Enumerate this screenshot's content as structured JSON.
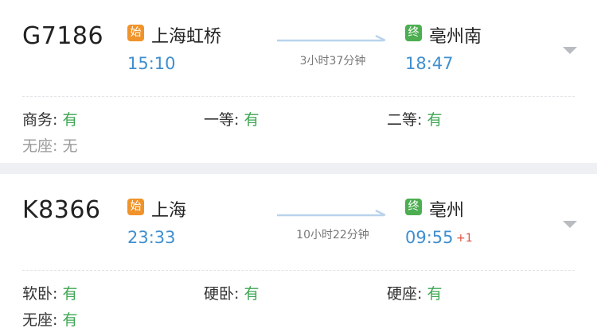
{
  "colors": {
    "time_blue": "#3f8fd0",
    "available_green": "#3ea653",
    "start_badge": "#f0932b",
    "end_badge": "#4cae50",
    "next_day_red": "#e24a3b"
  },
  "trains": [
    {
      "number": "G7186",
      "from": {
        "badge": "始",
        "station": "上海虹桥",
        "time": "15:10"
      },
      "to": {
        "badge": "终",
        "station": "亳州南",
        "time": "18:47",
        "day_offset": ""
      },
      "duration": "3小时37分钟",
      "expand_icon": "chevron-down-icon",
      "seats": [
        {
          "type": "商务:",
          "status": "有"
        },
        {
          "type": "一等:",
          "status": "有"
        },
        {
          "type": "二等:",
          "status": "有"
        },
        {
          "type": "无座:",
          "status": "无"
        }
      ]
    },
    {
      "number": "K8366",
      "from": {
        "badge": "始",
        "station": "上海",
        "time": "23:33"
      },
      "to": {
        "badge": "终",
        "station": "亳州",
        "time": "09:55",
        "day_offset": "+1"
      },
      "duration": "10小时22分钟",
      "expand_icon": "chevron-down-icon",
      "seats": [
        {
          "type": "软卧:",
          "status": "有"
        },
        {
          "type": "硬卧:",
          "status": "有"
        },
        {
          "type": "硬座:",
          "status": "有"
        },
        {
          "type": "无座:",
          "status": "有"
        }
      ]
    }
  ]
}
